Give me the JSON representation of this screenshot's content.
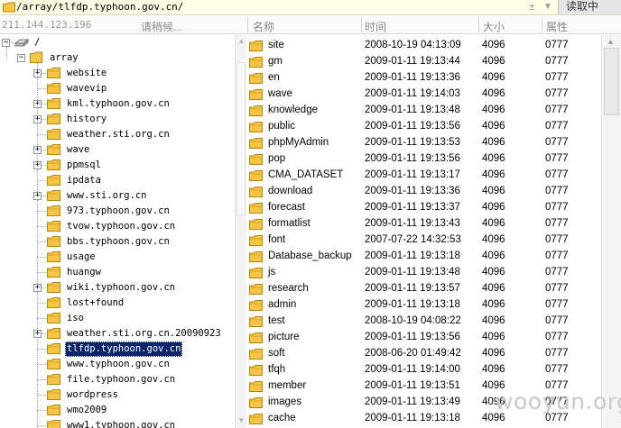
{
  "path_bar": {
    "path": "/array/tlfdp.typhoon.gov.cn/",
    "sort_icon": "sort-arrow-icon",
    "dropdown_icon": "chevron-down-icon",
    "status_button": "读取中"
  },
  "header": {
    "ip": "211.144.123.196",
    "waiting": "请稍候...",
    "columns": {
      "name": "名称",
      "time": "时间",
      "size": "大小",
      "attr": "属性"
    }
  },
  "tree": {
    "root": "/",
    "array": "array",
    "children": [
      {
        "label": "website",
        "expandable": true
      },
      {
        "label": "wavevip",
        "expandable": false
      },
      {
        "label": "kml.typhoon.gov.cn",
        "expandable": true
      },
      {
        "label": "history",
        "expandable": true
      },
      {
        "label": "weather.sti.org.cn",
        "expandable": false
      },
      {
        "label": "wave",
        "expandable": true
      },
      {
        "label": "ppmsql",
        "expandable": true
      },
      {
        "label": "ipdata",
        "expandable": false
      },
      {
        "label": "www.sti.org.cn",
        "expandable": true
      },
      {
        "label": "973.typhoon.gov.cn",
        "expandable": false
      },
      {
        "label": "tvow.typhoon.gov.cn",
        "expandable": false
      },
      {
        "label": "bbs.typhoon.gov.cn",
        "expandable": false
      },
      {
        "label": "usage",
        "expandable": false
      },
      {
        "label": "huangw",
        "expandable": false
      },
      {
        "label": "wiki.typhoon.gov.cn",
        "expandable": true
      },
      {
        "label": "lost+found",
        "expandable": false
      },
      {
        "label": "iso",
        "expandable": false
      },
      {
        "label": "weather.sti.org.cn.20090923",
        "expandable": true
      },
      {
        "label": "tlfdp.typhoon.gov.cn",
        "expandable": false,
        "selected": true
      },
      {
        "label": "www.typhoon.gov.cn",
        "expandable": false
      },
      {
        "label": "file.typhoon.gov.cn",
        "expandable": false
      },
      {
        "label": "wordpress",
        "expandable": false
      },
      {
        "label": "wmo2009",
        "expandable": false
      },
      {
        "label": "www1.typhoon.gov.cn",
        "expandable": false
      }
    ]
  },
  "files": [
    {
      "name": "site",
      "time": "2008-10-19 04:13:09",
      "size": "4096",
      "attr": "0777"
    },
    {
      "name": "gm",
      "time": "2009-01-11 19:13:44",
      "size": "4096",
      "attr": "0777"
    },
    {
      "name": "en",
      "time": "2009-01-11 19:13:36",
      "size": "4096",
      "attr": "0777"
    },
    {
      "name": "wave",
      "time": "2009-01-11 19:14:03",
      "size": "4096",
      "attr": "0777"
    },
    {
      "name": "knowledge",
      "time": "2009-01-11 19:13:48",
      "size": "4096",
      "attr": "0777"
    },
    {
      "name": "public",
      "time": "2009-01-11 19:13:56",
      "size": "4096",
      "attr": "0777"
    },
    {
      "name": "phpMyAdmin",
      "time": "2009-01-11 19:13:53",
      "size": "4096",
      "attr": "0777"
    },
    {
      "name": "pop",
      "time": "2009-01-11 19:13:56",
      "size": "4096",
      "attr": "0777"
    },
    {
      "name": "CMA_DATASET",
      "time": "2009-01-11 19:13:17",
      "size": "4096",
      "attr": "0777"
    },
    {
      "name": "download",
      "time": "2009-01-11 19:13:36",
      "size": "4096",
      "attr": "0777"
    },
    {
      "name": "forecast",
      "time": "2009-01-11 19:13:37",
      "size": "4096",
      "attr": "0777"
    },
    {
      "name": "formatlist",
      "time": "2009-01-11 19:13:43",
      "size": "4096",
      "attr": "0777"
    },
    {
      "name": "font",
      "time": "2007-07-22 14:32:53",
      "size": "4096",
      "attr": "0777"
    },
    {
      "name": "Database_backup",
      "time": "2009-01-11 19:13:18",
      "size": "4096",
      "attr": "0777"
    },
    {
      "name": "js",
      "time": "2009-01-11 19:13:48",
      "size": "4096",
      "attr": "0777"
    },
    {
      "name": "research",
      "time": "2009-01-11 19:13:57",
      "size": "4096",
      "attr": "0777"
    },
    {
      "name": "admin",
      "time": "2009-01-11 19:13:18",
      "size": "4096",
      "attr": "0777"
    },
    {
      "name": "test",
      "time": "2008-10-19 04:08:22",
      "size": "4096",
      "attr": "0777"
    },
    {
      "name": "picture",
      "time": "2009-01-11 19:13:56",
      "size": "4096",
      "attr": "0777"
    },
    {
      "name": "soft",
      "time": "2008-06-20 01:49:42",
      "size": "4096",
      "attr": "0777"
    },
    {
      "name": "tfqh",
      "time": "2009-01-11 19:14:00",
      "size": "4096",
      "attr": "0777"
    },
    {
      "name": "member",
      "time": "2009-01-11 19:13:51",
      "size": "4096",
      "attr": "0777"
    },
    {
      "name": "images",
      "time": "2009-01-11 19:13:49",
      "size": "4096",
      "attr": "0777"
    },
    {
      "name": "cache",
      "time": "2009-01-11 19:13:18",
      "size": "4096",
      "attr": "0777"
    }
  ],
  "watermark": "wooyun.org",
  "colors": {
    "selection": "#0a246a",
    "folder": "#f5c543",
    "path_bar": "#fffce6"
  }
}
